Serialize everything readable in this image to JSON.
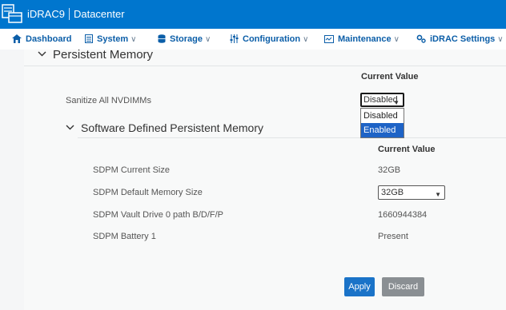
{
  "header": {
    "product": "iDRAC9",
    "server_name": "Datacenter"
  },
  "nav": [
    {
      "label": "Dashboard",
      "icon": "home-icon",
      "has_menu": false
    },
    {
      "label": "System",
      "icon": "server-icon",
      "has_menu": true
    },
    {
      "label": "Storage",
      "icon": "database-icon",
      "has_menu": true
    },
    {
      "label": "Configuration",
      "icon": "sliders-icon",
      "has_menu": true
    },
    {
      "label": "Maintenance",
      "icon": "monitor-icon",
      "has_menu": true
    },
    {
      "label": "iDRAC Settings",
      "icon": "gear-icon",
      "has_menu": true
    }
  ],
  "persistent_memory": {
    "title": "Persistent Memory",
    "col_header": "Current Value",
    "sanitize_label": "Sanitize All NVDIMMs",
    "sanitize_value": "Disabled",
    "sanitize_options": [
      "Disabled",
      "Enabled"
    ],
    "highlighted_option": "Enabled"
  },
  "sdpm": {
    "title": "Software Defined Persistent Memory",
    "col_header": "Current Value",
    "rows": [
      {
        "label": "SDPM Current Size",
        "value": "32GB"
      },
      {
        "label": "SDPM Default Memory Size",
        "value": "32GB"
      },
      {
        "label": "SDPM Vault Drive 0 path B/D/F/P",
        "value": "1660944384"
      },
      {
        "label": "SDPM Battery 1",
        "value": "Present"
      }
    ]
  },
  "actions": {
    "apply": "Apply",
    "discard": "Discard"
  },
  "colors": {
    "header_bg": "#0076ce",
    "nav_text": "#0b5ea8",
    "apply_bg": "#1a73c8",
    "discard_bg": "#8a8f93",
    "selected_option_bg": "#1e63c6"
  }
}
